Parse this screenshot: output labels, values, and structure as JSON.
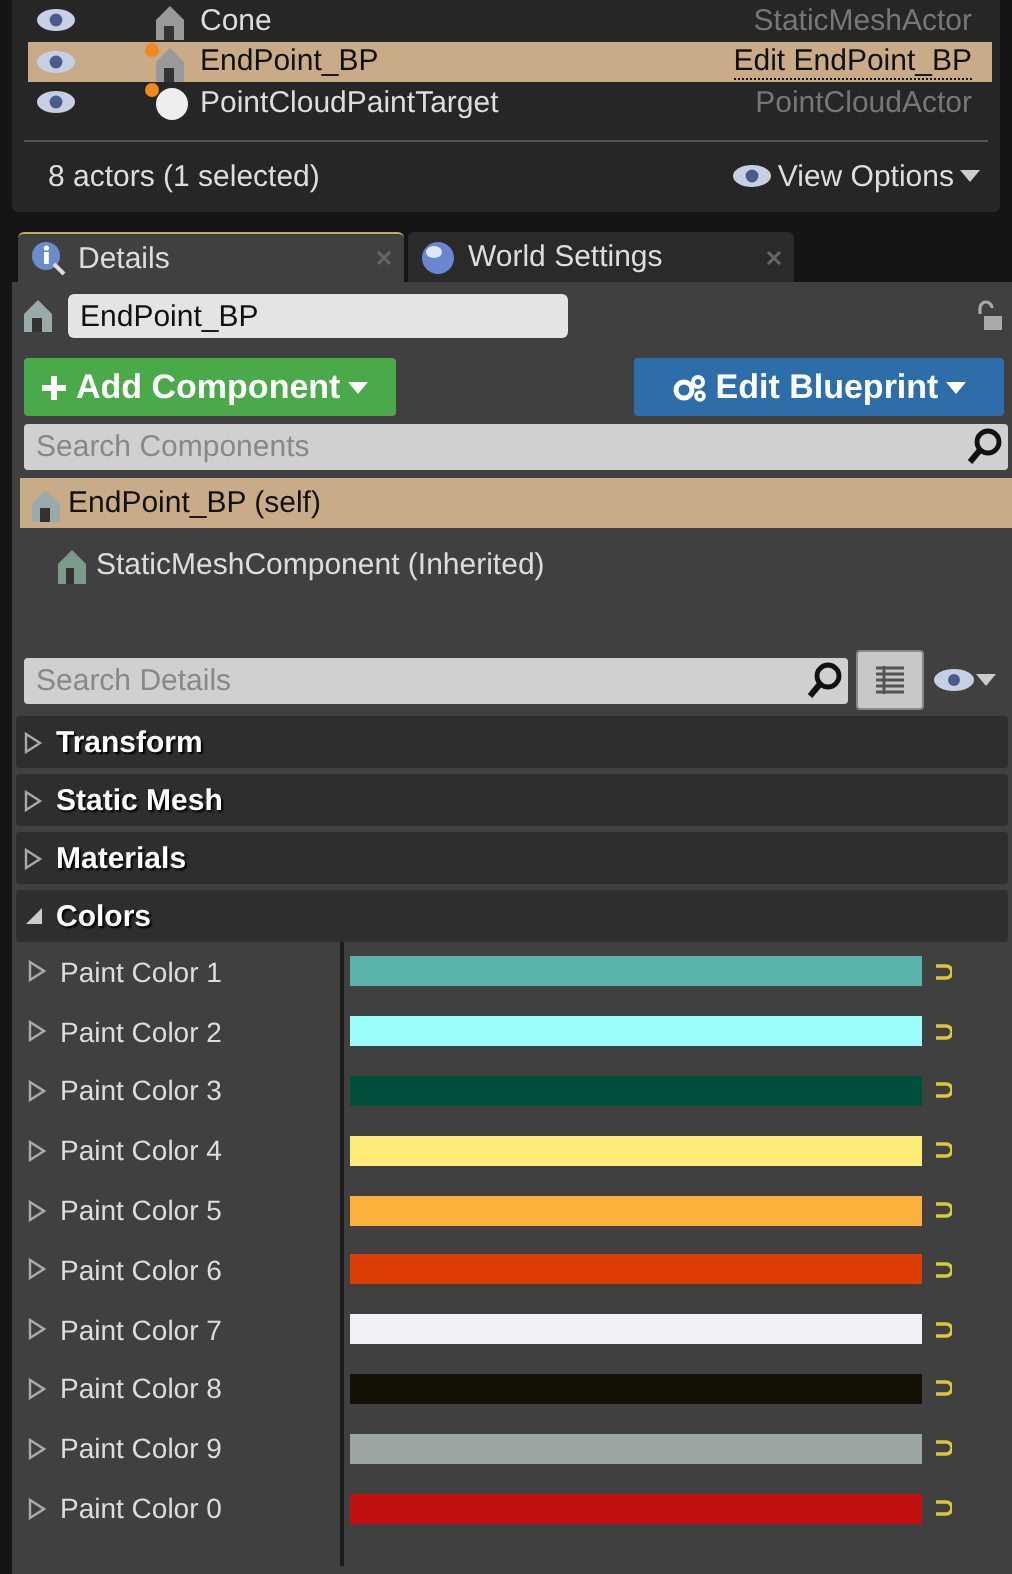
{
  "outliner": {
    "rows": [
      {
        "kind": "mesh",
        "name": "Cone",
        "type": "StaticMeshActor",
        "selected": false
      },
      {
        "kind": "blueprint",
        "name": "EndPoint_BP",
        "type": "Edit EndPoint_BP",
        "selected": true
      },
      {
        "kind": "sphere",
        "name": "PointCloudPaintTarget",
        "type": "PointCloudActor",
        "selected": false
      }
    ],
    "count": "8 actors (1 selected)",
    "view_options": "View Options"
  },
  "tabs": [
    {
      "label": "Details",
      "selected": true
    },
    {
      "label": "World Settings",
      "selected": false
    }
  ],
  "details": {
    "object_name": "EndPoint_BP",
    "add_component": "Add Component",
    "edit_blueprint": "Edit Blueprint",
    "search_components": {
      "placeholder": "Search Components"
    },
    "components": [
      {
        "label": "EndPoint_BP (self)",
        "selected": true,
        "children": [
          {
            "label": "StaticMeshComponent (Inherited)",
            "selected": false
          }
        ]
      }
    ],
    "search_details": {
      "placeholder": "Search Details"
    },
    "categories": [
      {
        "label": "Transform",
        "expanded": false
      },
      {
        "label": "Static Mesh",
        "expanded": false
      },
      {
        "label": "Materials",
        "expanded": false
      },
      {
        "label": "Colors",
        "expanded": true,
        "properties": [
          {
            "label": "Paint Color 1",
            "color": "#5ab3aa"
          },
          {
            "label": "Paint Color 2",
            "color": "#9bfdfa"
          },
          {
            "label": "Paint Color 3",
            "color": "#004f3d"
          },
          {
            "label": "Paint Color 4",
            "color": "#ffeb78"
          },
          {
            "label": "Paint Color 5",
            "color": "#fbb13a"
          },
          {
            "label": "Paint Color 6",
            "color": "#dc3d03"
          },
          {
            "label": "Paint Color 7",
            "color": "#f0f2f7"
          },
          {
            "label": "Paint Color 8",
            "color": "#141005"
          },
          {
            "label": "Paint Color 9",
            "color": "#9ca6a0"
          },
          {
            "label": "Paint Color 0",
            "color": "#c20f0f"
          }
        ]
      }
    ]
  }
}
